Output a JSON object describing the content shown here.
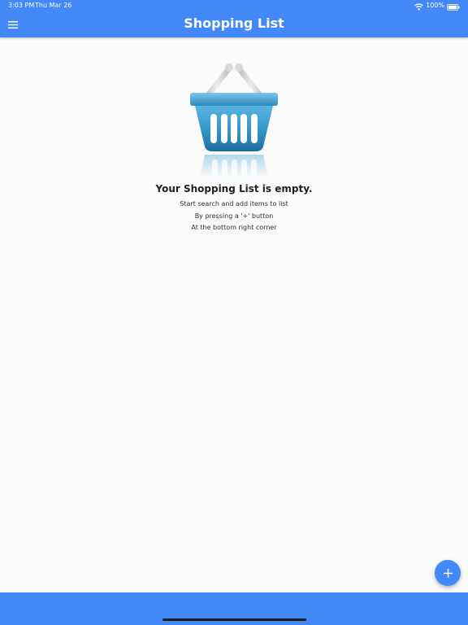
{
  "status_bar": {
    "time": "3:03 PM",
    "date": "Thu Mar 26",
    "battery": "100%"
  },
  "header": {
    "title": "Shopping List"
  },
  "empty_state": {
    "heading": "Your Shopping List is empty.",
    "line1": "Start search and add items to list",
    "line2": "By pressing a '+' button",
    "line3": "At the bottom right corner"
  },
  "colors": {
    "primary": "#4288f7",
    "background": "#fafafa",
    "basket": "#3a9ccf"
  },
  "icons": {
    "menu": "menu-icon",
    "add": "plus-icon",
    "basket": "shopping-basket-icon",
    "wifi": "wifi-icon",
    "battery": "battery-icon"
  }
}
